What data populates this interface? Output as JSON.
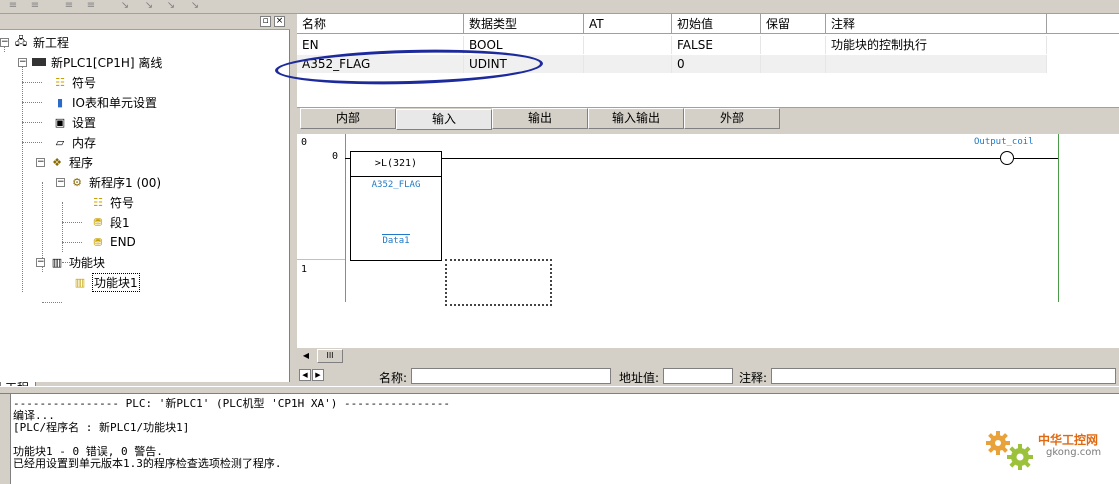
{
  "toolbar": {
    "icons": [
      "list-icon",
      "list-icon",
      "list-icon",
      "list-icon",
      "arrow-icon",
      "arrow-icon",
      "arrow-icon",
      "arrow-icon"
    ]
  },
  "tree": {
    "project": "新工程",
    "plc": "新PLC1[CP1H] 离线",
    "symbols": "符号",
    "io_table": "IO表和单元设置",
    "settings": "设置",
    "memory": "内存",
    "programs": "程序",
    "program1": "新程序1 (00)",
    "program_symbols": "符号",
    "section1": "段1",
    "end": "END",
    "function_blocks": "功能块",
    "fb1": "功能块1"
  },
  "left_tab": "工程",
  "var_table": {
    "headers": [
      "名称",
      "数据类型",
      "AT",
      "初始值",
      "保留",
      "注释"
    ],
    "rows": [
      [
        "EN",
        "BOOL",
        "",
        "FALSE",
        "",
        "功能块的控制执行"
      ],
      [
        "A352_FLAG",
        "UDINT",
        "",
        "0",
        "",
        ""
      ]
    ]
  },
  "tabs": [
    "内部",
    "输入",
    "输出",
    "输入输出",
    "外部"
  ],
  "active_tab": "输入",
  "ladder": {
    "rung0_num": "0",
    "rung0_step": "0",
    "rung1_num": "1",
    "fb_instruction": ">L(321)",
    "fb_operand1": "A352_FLAG",
    "fb_operand2": "Data1",
    "coil_label": "Output_coil"
  },
  "scrollbar_thumb": "III",
  "infobar": {
    "name_label": "名称:",
    "address_label": "地址值:",
    "comment_label": "注释:"
  },
  "output": {
    "line1": "---------------- PLC: '新PLC1' (PLC机型 'CP1H XA') ----------------",
    "line2": "编译...",
    "line3": "[PLC/程序名 : 新PLC1/功能块1]",
    "line4": "功能块1 - 0 错误, 0 警告.",
    "line5": "已经用设置到单元版本1.3的程序检查选项检测了程序."
  },
  "watermark": {
    "cn": "中华工控网",
    "en": "gkong.com"
  },
  "colors": {
    "annotation_circle": "#1c2a9c",
    "operand_text": "#1e7ac8",
    "rail_green": "#4a9a4a",
    "watermark_orange": "#e06a12"
  }
}
